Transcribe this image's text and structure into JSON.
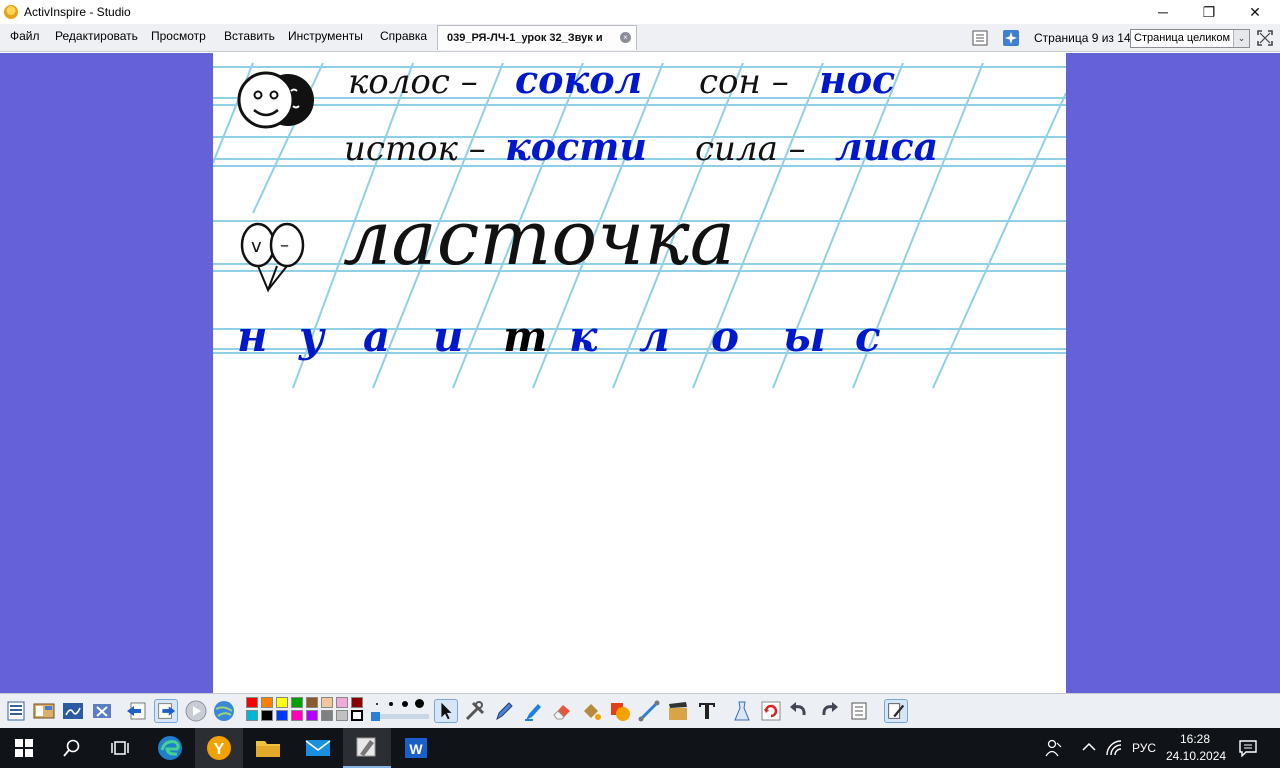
{
  "window": {
    "title": "ActivInspire - Studio",
    "controls": {
      "minimize": "─",
      "restore": "❐",
      "close": "✕"
    }
  },
  "menu": {
    "items": [
      "Файл",
      "Редактировать",
      "Просмотр",
      "Вставить",
      "Инструменты",
      "Справка"
    ]
  },
  "document_tab": {
    "label": "039_РЯ-ЛЧ-1_урок 32_Звук и",
    "close": "×"
  },
  "pager": {
    "text": "Страница 9 из 14",
    "zoom_value": "Страница целиком",
    "zoom_arrow": "⌄"
  },
  "worksheet": {
    "line1_black_1": "колос –",
    "line1_blue_1": "сокол",
    "line1_black_2": "сон –",
    "line1_blue_2": "нос",
    "line2_black_1": "исток –",
    "line2_blue_1": "кости",
    "line2_black_2": "сила –",
    "line2_blue_2": "лиса",
    "big_word": "ласточка",
    "scheme_left": "v",
    "scheme_right": "–",
    "letters": [
      {
        "ch": "н",
        "color": "#0018cc"
      },
      {
        "ch": "у",
        "color": "#0018cc"
      },
      {
        "ch": "а",
        "color": "#0018cc"
      },
      {
        "ch": "и",
        "color": "#0018cc"
      },
      {
        "ch": "т",
        "color": "#000000"
      },
      {
        "ch": "к",
        "color": "#0018cc"
      },
      {
        "ch": "л",
        "color": "#0018cc"
      },
      {
        "ch": "о",
        "color": "#0018cc"
      },
      {
        "ch": "ы",
        "color": "#0018cc"
      },
      {
        "ch": "с",
        "color": "#0018cc"
      }
    ],
    "ink_blue": "#0018cc",
    "ink_black": "#111111",
    "ruling_color": "#8fd0e6"
  },
  "palette": {
    "colors": [
      "#ff0000",
      "#ff8000",
      "#ffff00",
      "#00a000",
      "#8b5a2b",
      "#f4c79a",
      "#f2a8d8",
      "#8b0000",
      "#00b7d9",
      "#000000",
      "#0038ff",
      "#ff00b4",
      "#b400ff",
      "#808080",
      "#c0c0c0",
      "#ffffff"
    ]
  },
  "taskbar": {
    "time": "16:28",
    "date": "24.10.2024",
    "lang": "РУС",
    "colors": {
      "edge": "#1f7fcf",
      "yandex": "#f2a200",
      "word": "#1b5ec9",
      "folder": "#f0c040",
      "mail": "#1a8fe0"
    }
  }
}
